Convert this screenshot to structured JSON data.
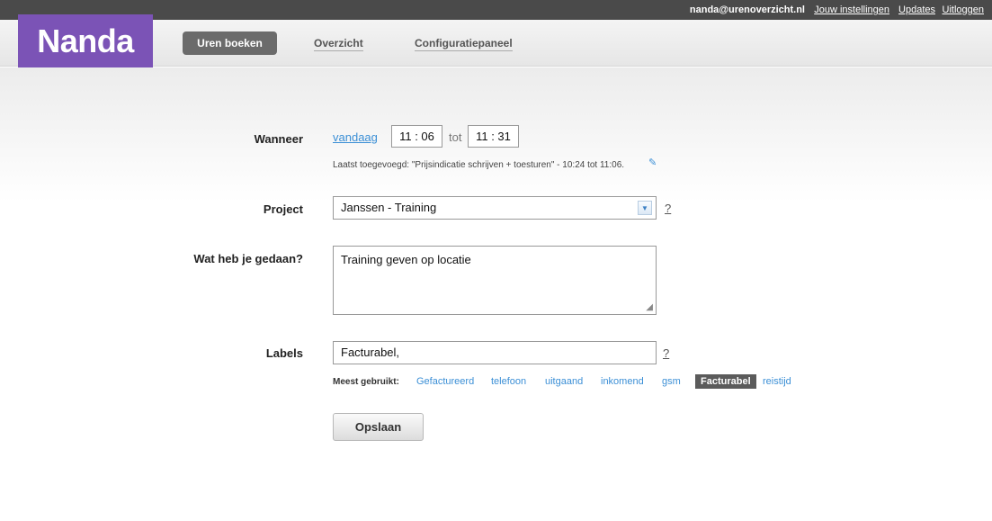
{
  "topbar": {
    "user_email": "nanda@urenoverzicht.nl",
    "links": [
      "Jouw instellingen",
      "Updates",
      "Uitloggen"
    ]
  },
  "header": {
    "logo_text": "Nanda",
    "nav": [
      "Uren boeken",
      "Overzicht",
      "Configuratiepaneel"
    ],
    "active_nav": "Uren boeken"
  },
  "form": {
    "wanneer": {
      "label": "Wanneer",
      "link": "vandaag",
      "start": "11 : 06",
      "tot": "tot",
      "end": "11 : 31",
      "last_added": "Laatst toegevoegd: \"Prijsindicatie schrijven + toesturen\" - 10:24 tot 11:06."
    },
    "project": {
      "label": "Project",
      "value": "Janssen - Training",
      "help": "?"
    },
    "wat": {
      "label": "Wat heb je gedaan?",
      "value": "Training geven op locatie"
    },
    "labels": {
      "label": "Labels",
      "value": "Facturabel,",
      "help": "?",
      "meest_gebruikt": "Meest gebruikt:",
      "tags": [
        "Gefactureerd",
        "telefoon",
        "uitgaand",
        "inkomend",
        "gsm",
        "Facturabel",
        "reistijd"
      ],
      "active_tag": "Facturabel"
    },
    "save_label": "Opslaan"
  },
  "colors": {
    "brand": "#7b53b6",
    "link": "#3b8fd6",
    "topbar": "#4a4a4a"
  }
}
